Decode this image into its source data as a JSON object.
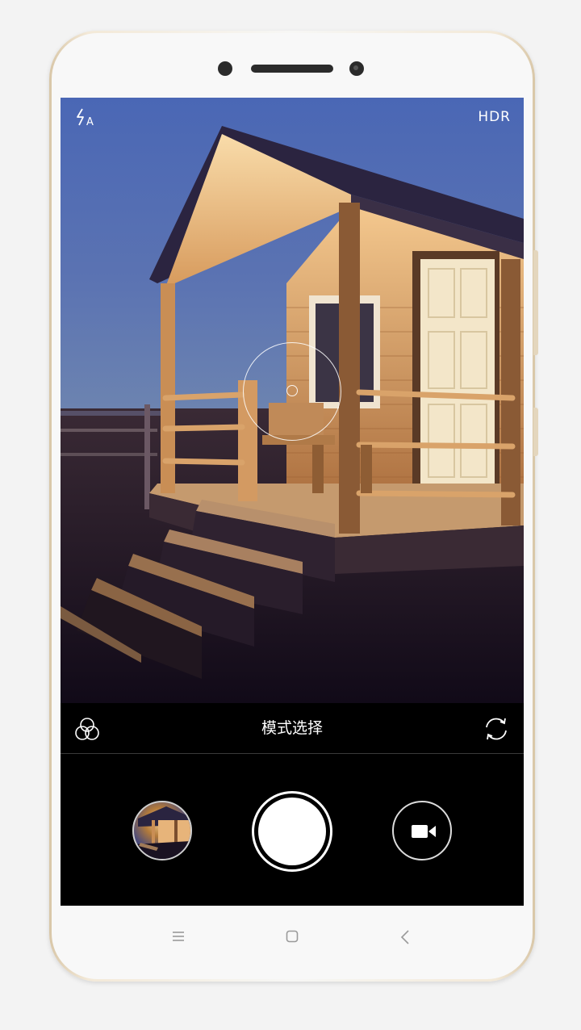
{
  "mode_bar": {
    "label": "模式选择"
  },
  "status_icons": {
    "flash": "ϟA",
    "hdr": "HDR"
  },
  "icons": {
    "flash": "flash-auto-icon",
    "hdr": "hdr-icon",
    "filter": "filter-icon",
    "switch_camera": "switch-camera-icon",
    "shutter": "shutter-icon",
    "video": "video-camera-icon",
    "menu": "menu-icon",
    "home": "home-icon",
    "back": "back-icon"
  },
  "colors": {
    "accent": "#ffffff",
    "phone_frame": "#e4d6bd",
    "control_bg": "#000000"
  }
}
